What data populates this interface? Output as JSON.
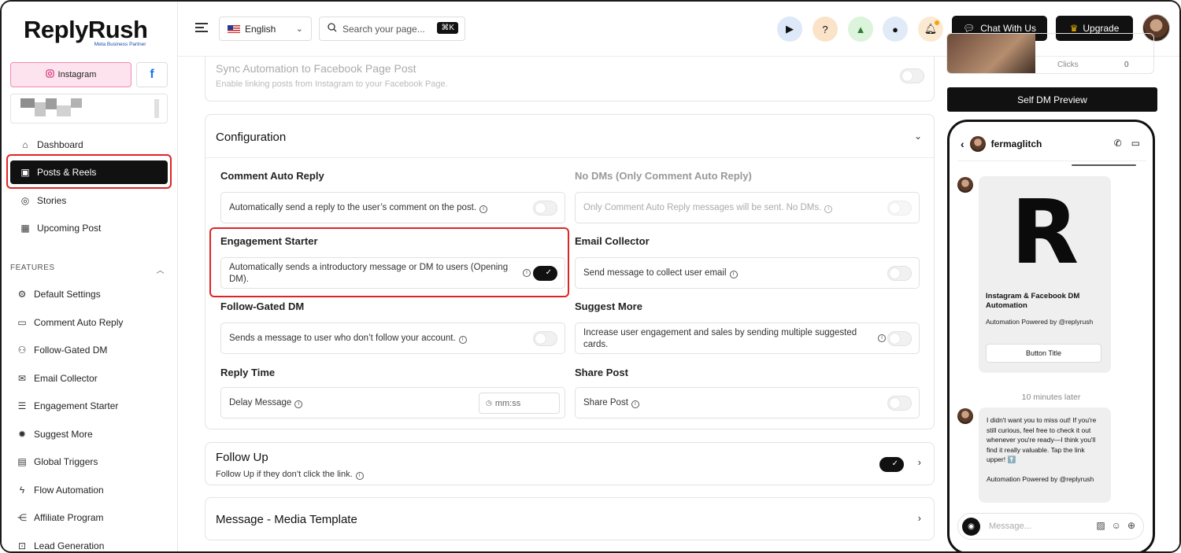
{
  "app": {
    "brand": "ReplyRush",
    "partner": "Meta Business Partner"
  },
  "sidebar": {
    "instagram_label": "Instagram",
    "facebook_label": "f",
    "nav": [
      {
        "label": "Dashboard",
        "icon": "home-icon"
      },
      {
        "label": "Posts & Reels",
        "icon": "image-icon",
        "active": true
      },
      {
        "label": "Stories",
        "icon": "instagram-icon"
      },
      {
        "label": "Upcoming Post",
        "icon": "calendar-icon"
      }
    ],
    "features_label": "FEATURES",
    "features": [
      {
        "label": "Default Settings",
        "icon": "gear-icon"
      },
      {
        "label": "Comment Auto Reply",
        "icon": "comment-icon"
      },
      {
        "label": "Follow-Gated DM",
        "icon": "users-icon"
      },
      {
        "label": "Email Collector",
        "icon": "email-icon"
      },
      {
        "label": "Engagement Starter",
        "icon": "message-icon"
      },
      {
        "label": "Suggest More",
        "icon": "badge-icon"
      },
      {
        "label": "Global Triggers",
        "icon": "list-icon"
      },
      {
        "label": "Flow Automation",
        "icon": "bolt-icon"
      },
      {
        "label": "Affiliate Program",
        "icon": "share-icon"
      },
      {
        "label": "Lead Generation",
        "icon": "lead-icon"
      }
    ]
  },
  "topbar": {
    "language": "English",
    "search_placeholder": "Search your page...",
    "search_shortcut": "⌘K",
    "chat_label": "Chat With Us",
    "upgrade_label": "Upgrade"
  },
  "main": {
    "sync": {
      "title": "Sync Automation to Facebook Page Post",
      "subtitle": "Enable linking posts from Instagram to your Facebook Page.",
      "enabled": false
    },
    "configuration": {
      "title": "Configuration",
      "options": [
        {
          "title": "Comment Auto Reply",
          "text": "Automatically send a reply to the user’s comment on the post.",
          "enabled": false
        },
        {
          "title": "No DMs (Only Comment Auto Reply)",
          "text": "Only Comment Auto Reply messages will be sent. No DMs.",
          "enabled": false,
          "disabled": true
        },
        {
          "title": "Engagement Starter",
          "text": "Automatically sends a introductory message or DM to users (Opening DM).",
          "enabled": true
        },
        {
          "title": "Email Collector",
          "text": "Send message to collect user email",
          "enabled": false
        },
        {
          "title": "Follow-Gated DM",
          "text": "Sends a message to user who don’t follow your account.",
          "enabled": false
        },
        {
          "title": "Suggest More",
          "text": "Increase user engagement and sales by sending multiple suggested cards.",
          "enabled": false
        },
        {
          "title": "Reply Time",
          "text": "Delay Message",
          "input_placeholder": "mm:ss"
        },
        {
          "title": "Share Post",
          "text": "Share Post",
          "enabled": false
        }
      ]
    },
    "follow_up": {
      "title": "Follow Up",
      "subtitle": "Follow Up if they don’t click the link.",
      "enabled": true
    },
    "media_template": {
      "title": "Message - Media Template"
    }
  },
  "preview": {
    "thumb_stat_label": "Clicks",
    "thumb_stat_value": "0",
    "self_dm_label": "Self DM Preview",
    "username": "fermaglitch",
    "card_logo": "R",
    "card_title": "Instagram & Facebook DM Automation",
    "card_subtitle": "Automation Powered by @replyrush",
    "card_button": "Button Title",
    "time_separator": "10 minutes later",
    "message": "I didn't want you to miss out! If you're still curious, feel free to check it out whenever you're ready—I think you'll find it really valuable. Tap the link upper! ⬆️",
    "message_footer": "Automation Powered by @replyrush",
    "input_placeholder": "Message..."
  }
}
